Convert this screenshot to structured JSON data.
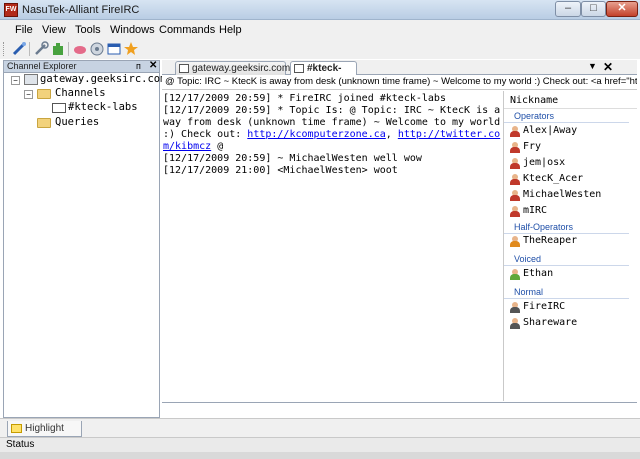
{
  "window": {
    "title": "NasuTek-Alliant FireIRC",
    "app_icon_text": "FW",
    "minimize": "–",
    "maximize": "□",
    "close": "✕"
  },
  "menu": {
    "items": [
      "File",
      "View",
      "Tools",
      "Windows",
      "Commands",
      "Help"
    ]
  },
  "toolbar": {
    "icons": [
      "connect-icon",
      "settings-icon",
      "plugin-icon",
      "highlight-icon",
      "log-icon",
      "window-icon",
      "star-icon"
    ]
  },
  "explorer": {
    "title": "Channel Explorer",
    "pin": "ᴨ",
    "close": "✕",
    "server": "gateway.geeksirc.com",
    "channels_label": "Channels",
    "channel": "#kteck-labs",
    "queries_label": "Queries",
    "expanded": "−"
  },
  "tabs": {
    "items": [
      {
        "label": "gateway.geeksirc.com"
      },
      {
        "label": "#kteck-labs"
      }
    ],
    "dropdown": "▼",
    "close": "✕"
  },
  "topic": "@ Topic: IRC ~ KtecK is away from desk (unknown time frame) ~ Welcome to my world :) Check out: <a href=\"http",
  "chat": {
    "l1": "[12/17/2009 20:59] * FireIRC joined #kteck-labs",
    "l2a": "[12/17/2009 20:59] * Topic Is: @ Topic: IRC ~ KtecK is away from desk (unknown time frame) ~ Welcome to my world :) Check out: ",
    "link1": "http://kcomputerzone.ca",
    "l2b": ", ",
    "link2": "http://twitter.com/kibmcz",
    "l2c": " @",
    "l3": "[12/17/2009 20:59] ~ MichaelWesten well wow",
    "l4": "[12/17/2009 21:00] <MichaelWesten> woot"
  },
  "nicklist": {
    "header": "Nickname",
    "groups": {
      "operators": "Operators",
      "halfops": "Half-Operators",
      "voiced": "Voiced",
      "normal": "Normal"
    },
    "operators": [
      "Alex|Away",
      "Fry",
      "jem|osx",
      "KtecK_Acer",
      "MichaelWesten",
      "mIRC"
    ],
    "halfops": [
      "TheReaper"
    ],
    "voiced": [
      "Ethan"
    ],
    "normal": [
      "FireIRC",
      "Shareware"
    ],
    "colors": {
      "operator": "#c0392b",
      "halfop": "#e08a1e",
      "voiced": "#5fa83a",
      "normal": "#555555",
      "group_text": "#1f4fa8"
    }
  },
  "bottom": {
    "highlight_tab": "Highlight Log"
  },
  "status": "Status"
}
